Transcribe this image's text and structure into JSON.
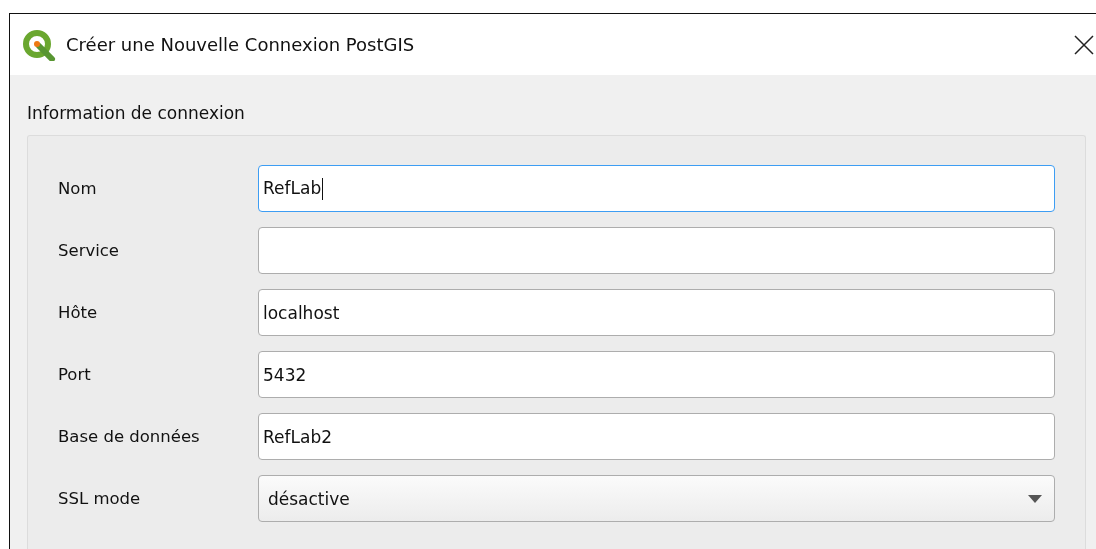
{
  "window": {
    "title": "Créer une Nouvelle Connexion PostGIS"
  },
  "group": {
    "title": "Information de connexion"
  },
  "fields": [
    {
      "label": "Nom",
      "kind": "text",
      "value": "RefLab",
      "focused": true
    },
    {
      "label": "Service",
      "kind": "text",
      "focused": false
    },
    {
      "label": "Hôte",
      "kind": "text",
      "value": "localhost",
      "focused": false
    },
    {
      "label": "Port",
      "kind": "text",
      "value": "5432",
      "focused": false
    },
    {
      "label": "Base de données",
      "kind": "text",
      "value": "RefLab2",
      "focused": false
    },
    {
      "label": "SSL mode",
      "kind": "select",
      "value": "désactive",
      "focused": false
    }
  ]
}
